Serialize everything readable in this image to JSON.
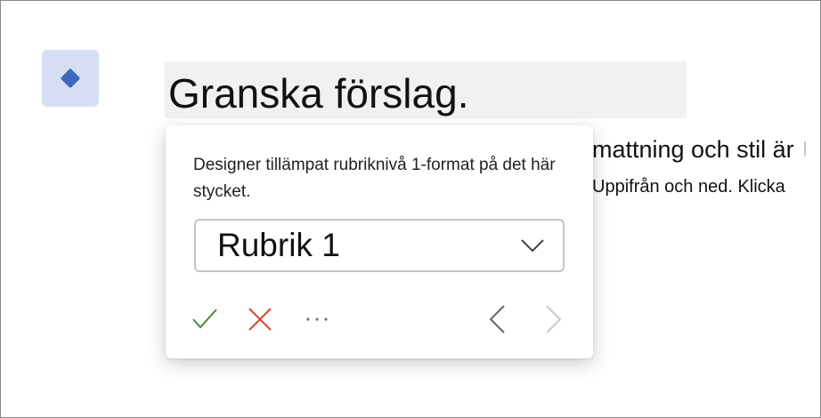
{
  "document": {
    "heading": "Granska förslag.",
    "body_line_1": "mattning och stil är",
    "body_line_2": "Uppifrån och ned. Klicka"
  },
  "designer_popup": {
    "message": "Designer tillämpat rubriknivå 1-format på det här stycket.",
    "style_select": {
      "selected": "Rubrik 1"
    },
    "icons": {
      "accept": "checkmark-icon",
      "reject": "close-icon",
      "more": "more-options-icon",
      "previous": "chevron-left-icon",
      "next": "chevron-right-icon"
    }
  },
  "colors": {
    "accept": "#4a8a3c",
    "reject": "#d14a34",
    "designer_accent": "#3f67c1",
    "designer_badge_bg": "#d5def2",
    "nav_enabled": "#666666",
    "nav_disabled": "#c8c8c8"
  }
}
